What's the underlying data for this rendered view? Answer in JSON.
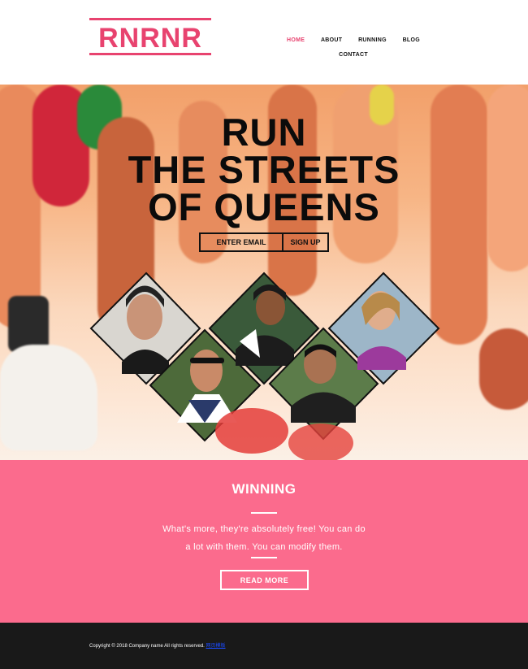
{
  "brand": {
    "logo_text": "RNRNR",
    "accent": "#e8436f"
  },
  "nav": {
    "items": [
      {
        "label": "HOME",
        "active": true
      },
      {
        "label": "ABOUT",
        "active": false
      },
      {
        "label": "RUNNING",
        "active": false
      },
      {
        "label": "BLOG",
        "active": false
      },
      {
        "label": "CONTACT",
        "active": false
      }
    ]
  },
  "hero": {
    "title_lines": [
      "RUN",
      "THE STREETS",
      "OF QUEENS"
    ],
    "email_placeholder": "ENTER EMAIL",
    "signup_label": "SIGN UP"
  },
  "winning": {
    "title": "WINNING",
    "text_line1": "What's more, they're absolutely free! You can do",
    "text_line2": "a lot with them. You can modify them.",
    "button_label": "READ MORE",
    "background": "#fb6b8d"
  },
  "footer": {
    "copyright": "Copyright © 2018 Company name All rights reserved.",
    "link_label": "网页模板",
    "background": "#191919"
  }
}
